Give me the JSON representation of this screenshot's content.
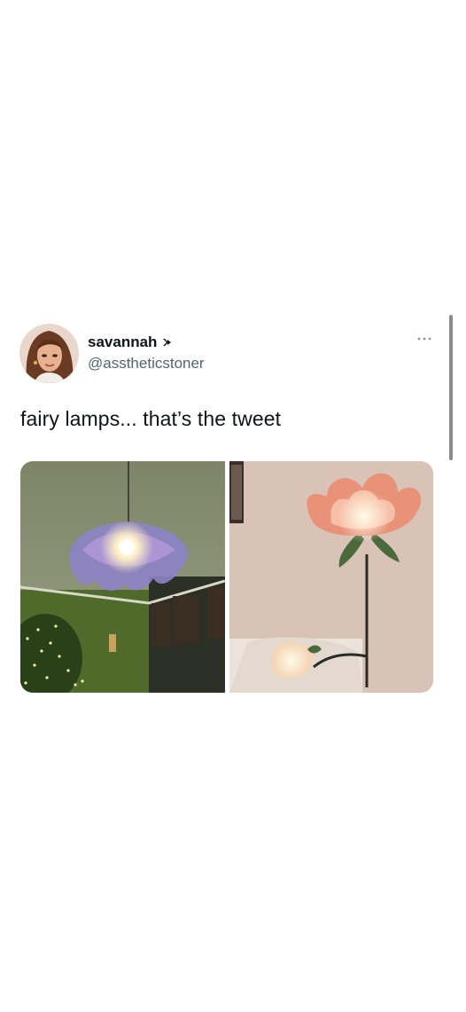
{
  "tweet": {
    "author": {
      "display_name": "savannah",
      "handle": "@asstheticstoner"
    },
    "text": "fairy lamps... that’s the tweet",
    "media": [
      {
        "description_icon": "photo"
      },
      {
        "description_icon": "photo"
      }
    ]
  },
  "colors": {
    "text_primary": "#0f1419",
    "text_secondary": "#536471",
    "background": "#ffffff"
  }
}
